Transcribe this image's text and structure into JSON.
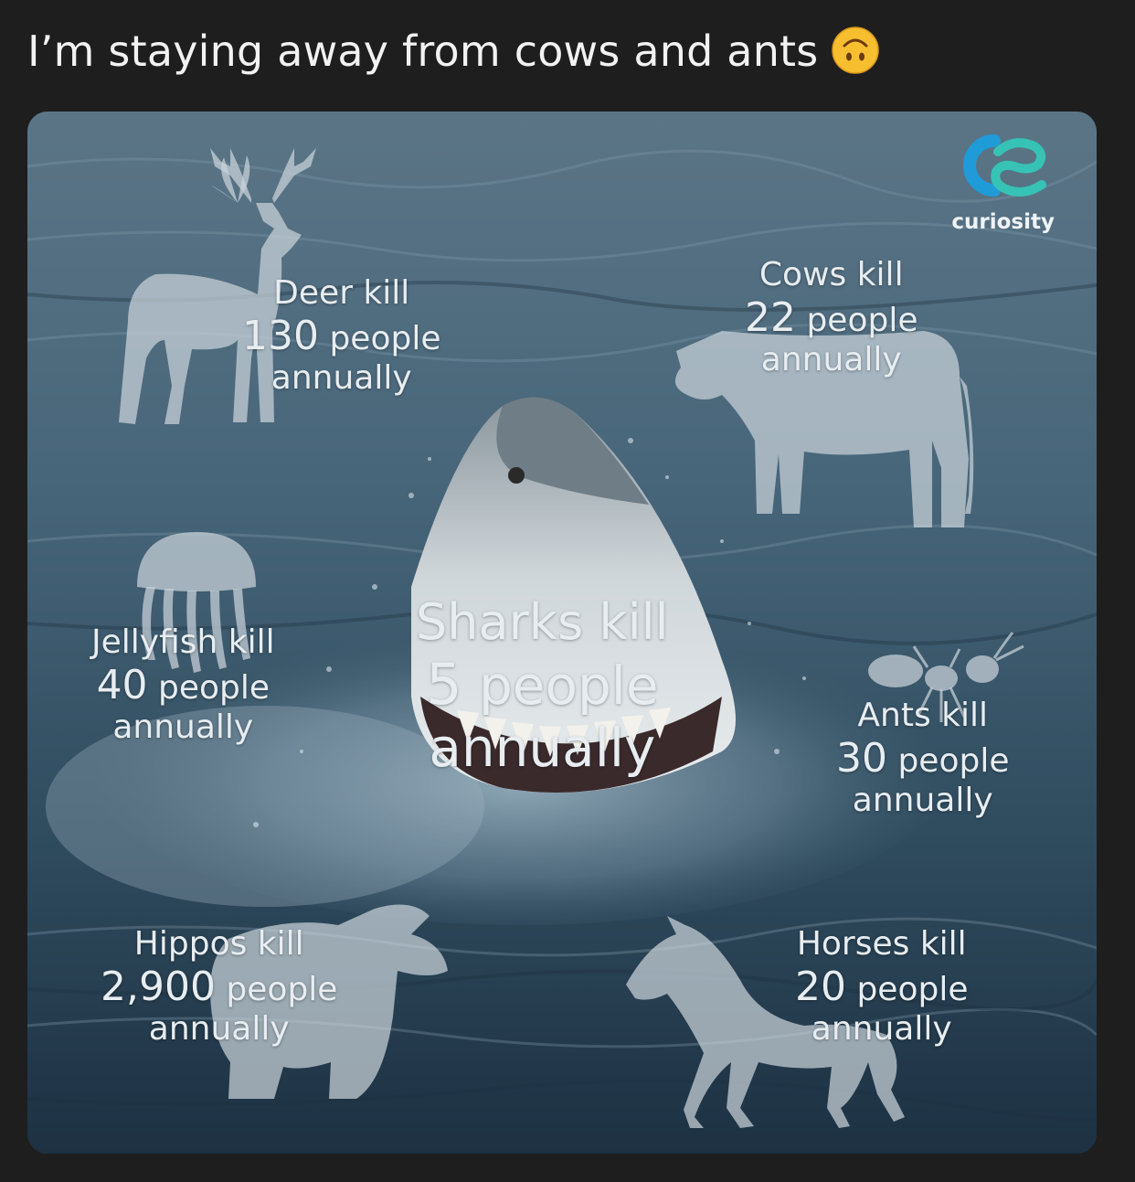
{
  "post": {
    "caption": "I’m staying away from cows and ants",
    "emoji": "upside-down-face-emoji"
  },
  "infographic": {
    "brand": "curiosity",
    "stats": {
      "deer": {
        "line1": "Deer kill",
        "number": "130",
        "unit": "people",
        "line3": "annually"
      },
      "cows": {
        "line1": "Cows kill",
        "number": "22",
        "unit": "people",
        "line3": "annually"
      },
      "jellyfish": {
        "line1": "Jellyfish kill",
        "number": "40",
        "unit": "people",
        "line3": "annually"
      },
      "sharks": {
        "line1": "Sharks kill",
        "number": "5",
        "unit": "people",
        "line3": "annually"
      },
      "ants": {
        "line1": "Ants kill",
        "number": "30",
        "unit": "people",
        "line3": "annually"
      },
      "hippos": {
        "line1": "Hippos kill",
        "number": "2,900",
        "unit": "people",
        "line3": "annually"
      },
      "horses": {
        "line1": "Horses kill",
        "number": "20",
        "unit": "people",
        "line3": "annually"
      }
    }
  },
  "colors": {
    "page_bg": "#1e1e1f",
    "caption_text": "#f2f2f2",
    "water_dark": "#1f3545",
    "water_mid": "#3c5a6d",
    "silhouette": "#c9d3da",
    "brand_blue": "#1f9bd7",
    "brand_teal": "#36c3b5"
  }
}
